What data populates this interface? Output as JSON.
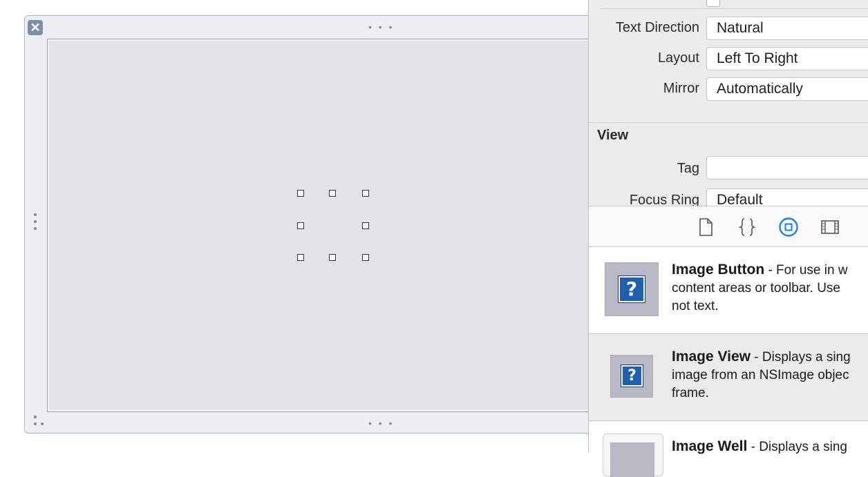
{
  "canvas": {
    "close_symbol": "✕",
    "top_grip": "• • •",
    "bottom_grip": "• • •",
    "corner_grip": "⠂⠂"
  },
  "inspector": {
    "rows": [
      {
        "label": "Text Direction",
        "value": "Natural"
      },
      {
        "label": "Layout",
        "value": "Left To Right"
      },
      {
        "label": "Mirror",
        "value": "Automatically"
      }
    ],
    "view_section": {
      "title": "View",
      "tag_label": "Tag",
      "tag_value": "",
      "focus_ring_label": "Focus Ring",
      "focus_ring_value": "Default"
    },
    "tabs": [
      {
        "name": "file-template-icon"
      },
      {
        "name": "code-snippet-icon"
      },
      {
        "name": "object-library-icon",
        "selected": true
      },
      {
        "name": "media-library-icon"
      }
    ],
    "accent_color": "#1a7ff0"
  },
  "library": {
    "items": [
      {
        "title": "Image Button",
        "desc_line1": " - For use in w",
        "desc_line2": "content areas or toolbar. Use",
        "desc_line3": "not text."
      },
      {
        "title": "Image View",
        "desc_line1": " - Displays a sing",
        "desc_line2": "image from an NSImage objec",
        "desc_line3": "frame."
      },
      {
        "title": "Image Well",
        "desc_line1": " - Displays a sing",
        "desc_line2": "",
        "desc_line3": ""
      }
    ],
    "question_glyph": "?"
  }
}
